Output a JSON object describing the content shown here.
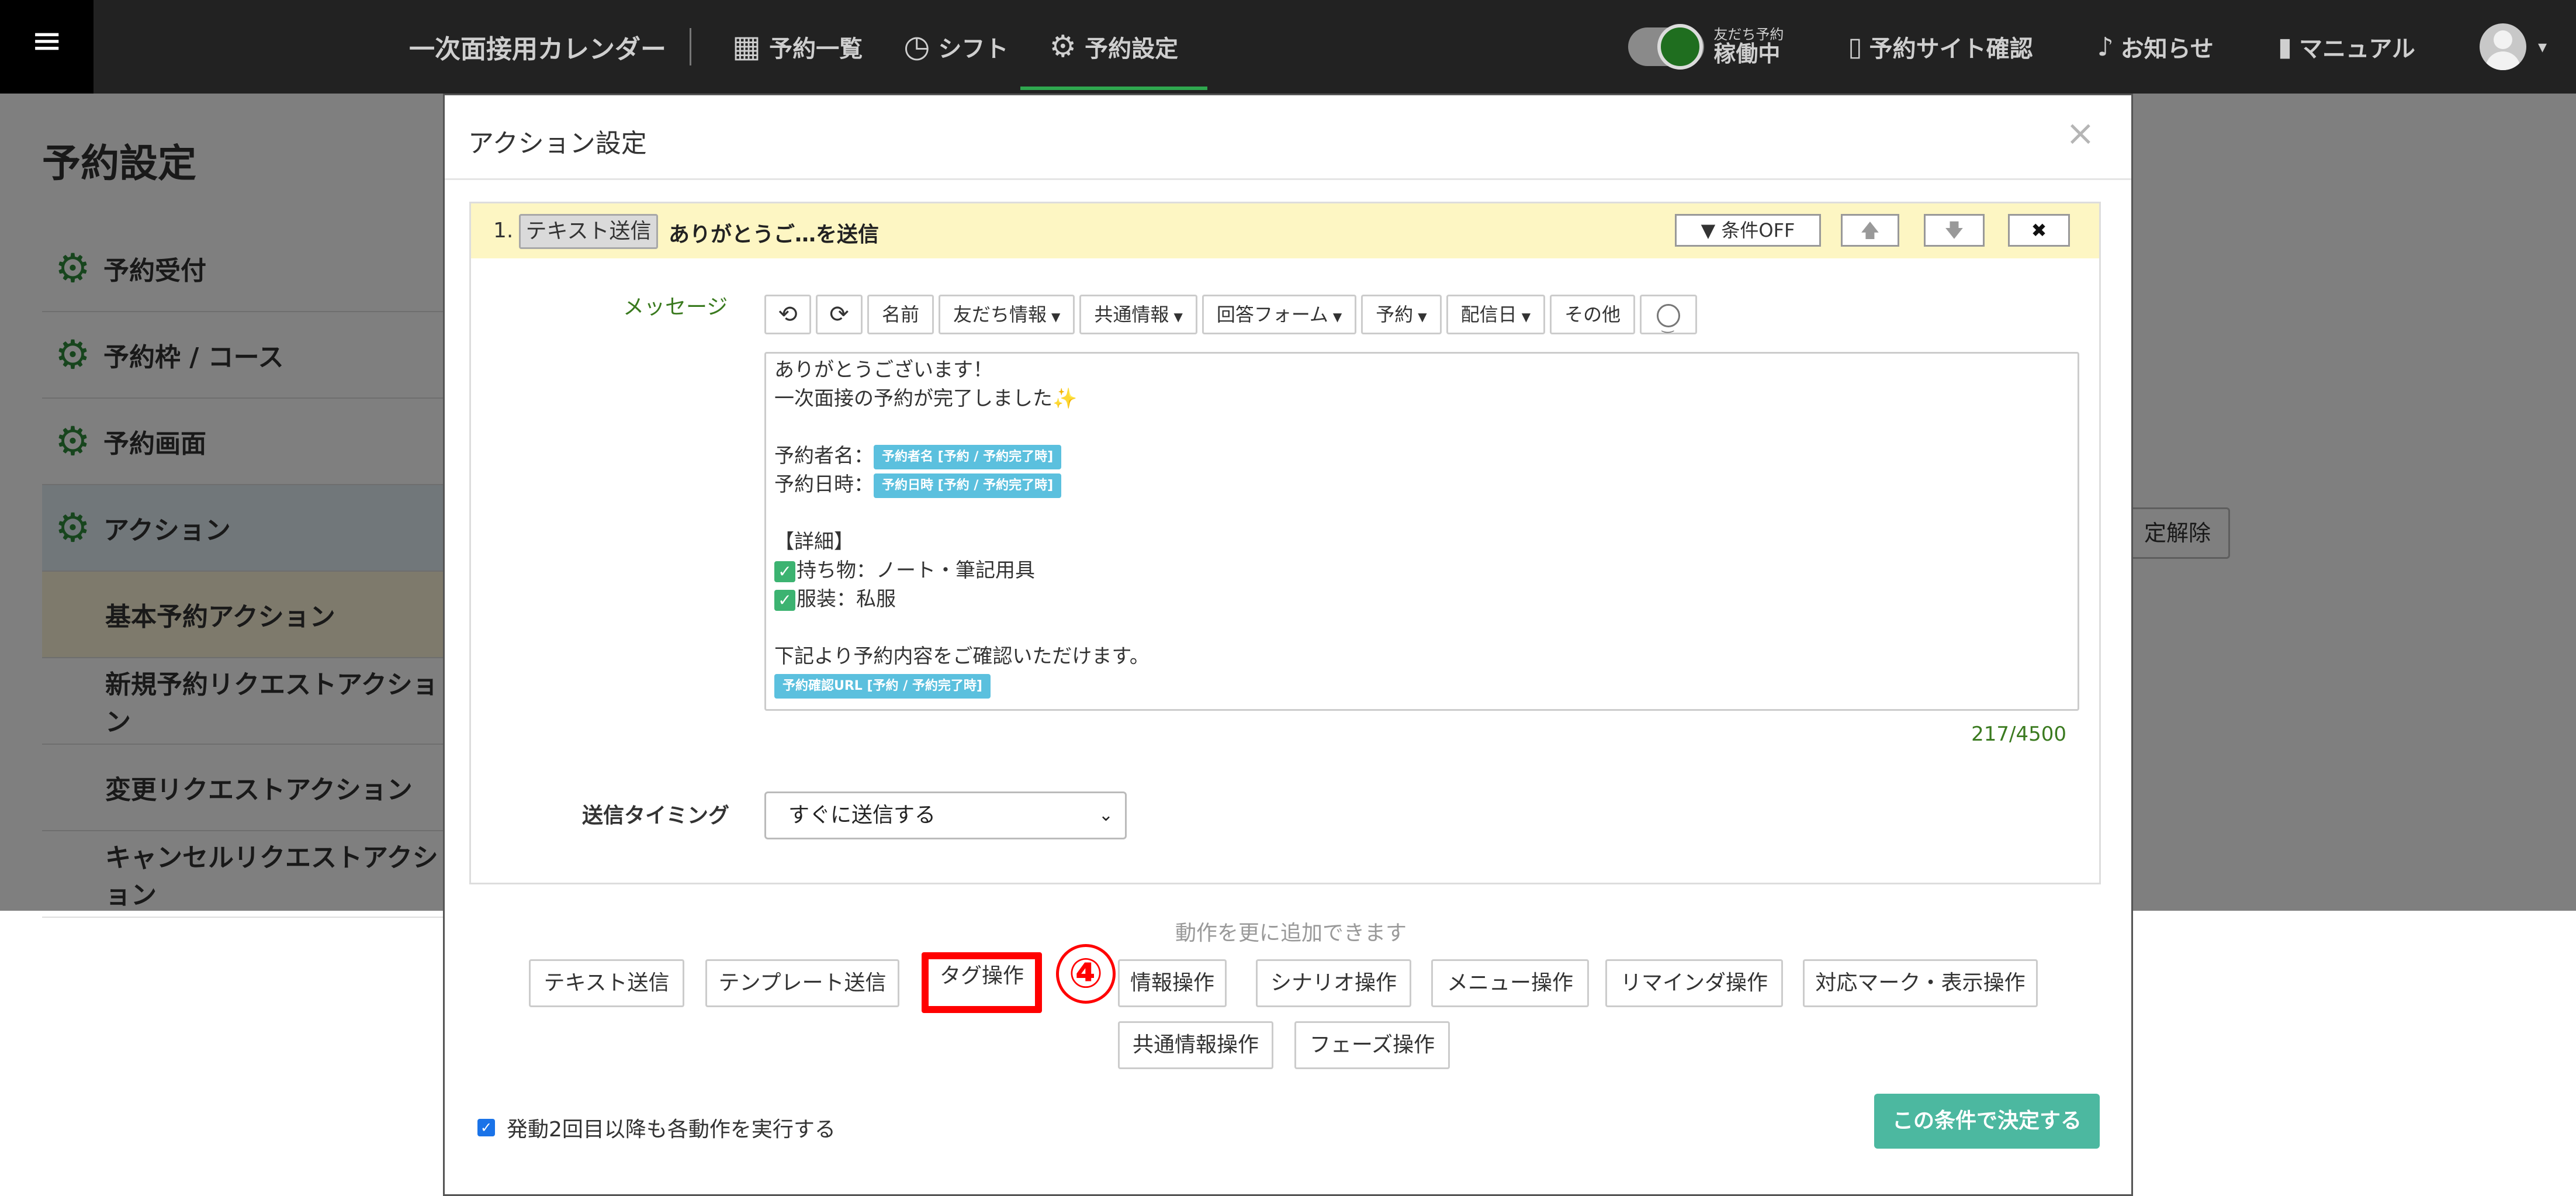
{
  "topbar": {
    "calendar_title": "一次面接用カレンダー",
    "nav": [
      {
        "label": "予約一覧",
        "icon": "calendar-icon"
      },
      {
        "label": "シフト",
        "icon": "clock-icon"
      },
      {
        "label": "予約設定",
        "icon": "gear-icon"
      }
    ],
    "toggle": {
      "small": "友だち予約",
      "big": "稼働中"
    },
    "right_nav": [
      {
        "label": "予約サイト確認",
        "icon": "phone-icon"
      },
      {
        "label": "お知らせ",
        "icon": "bell-icon"
      },
      {
        "label": "マニュアル",
        "icon": "book-icon"
      }
    ]
  },
  "page": {
    "title": "予約設定",
    "menu": [
      {
        "label": "予約受付"
      },
      {
        "label": "予約枠 / コース"
      },
      {
        "label": "予約画面"
      },
      {
        "label": "アクション"
      }
    ],
    "submenu": [
      {
        "label": "基本予約アクション"
      },
      {
        "label": "新規予約リクエストアクション"
      },
      {
        "label": "変更リクエストアクション"
      },
      {
        "label": "キャンセルリクエストアクション"
      }
    ],
    "bg_button": "定解除"
  },
  "modal": {
    "title": "アクション設定",
    "close": "×",
    "action": {
      "number": "1.",
      "type": "テキスト送信",
      "summary": "ありがとうご…を送信",
      "cond_button": "条件OFF",
      "up": "🡅",
      "down": "🡇",
      "delete": "✖"
    },
    "message_label": "メッセージ",
    "toolbar": {
      "undo": "⟲",
      "redo": "⟳",
      "name": "名前",
      "dropdowns": [
        "友だち情報",
        "共通情報",
        "回答フォーム",
        "予約",
        "配信日"
      ],
      "other": "その他"
    },
    "editor": {
      "line1": "ありがとうございます！",
      "line2": "一次面接の予約が完了しました",
      "sparkle": "✨",
      "line3_label": "予約者名：",
      "line3_tag": "予約者名 [予約 / 予約完了時]",
      "line4_label": "予約日時：",
      "line4_tag": "予約日時 [予約 / 予約完了時]",
      "line5": "【詳細】",
      "check": "✓",
      "line6": "持ち物：ノート・筆記用具",
      "line7": "服装：私服",
      "line8": "下記より予約内容をご確認いただけます。",
      "line9_tag": "予約確認URL [予約 / 予約完了時]"
    },
    "counter": "217/4500",
    "timing_label": "送信タイミング",
    "timing_value": "すぐに送信する",
    "hint": "動作を更に追加できます",
    "operations_row1": [
      "テキスト送信",
      "テンプレート送信",
      "タグ操作",
      "情報操作",
      "シナリオ操作",
      "メニュー操作",
      "リマインダ操作",
      "対応マーク・表示操作"
    ],
    "operations_row2": [
      "共通情報操作",
      "フェーズ操作"
    ],
    "step_marker": "④",
    "repeat_label": "発動2回目以降も各動作を実行する",
    "submit": "この条件で決定する"
  }
}
